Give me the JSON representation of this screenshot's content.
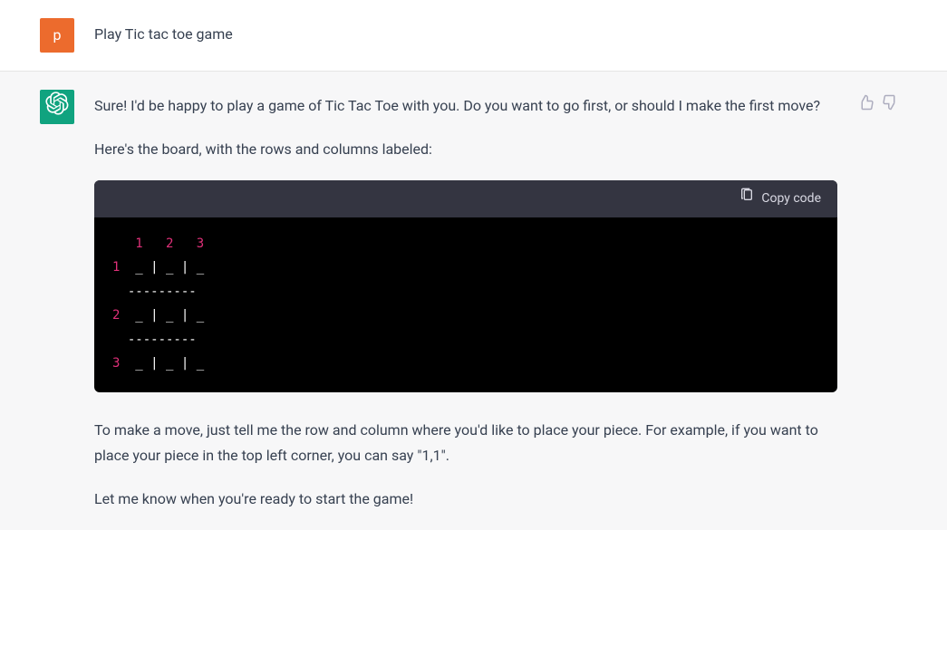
{
  "user": {
    "avatar_letter": "p",
    "message": "Play Tic tac toe game"
  },
  "assistant": {
    "paragraph1": "Sure! I'd be happy to play a game of Tic Tac Toe with you. Do you want to go first, or should I make the first move?",
    "paragraph2": "Here's the board, with the rows and columns labeled:",
    "paragraph3": "To make a move, just tell me the row and column where you'd like to place your piece. For example, if you want to place your piece in the top left corner, you can say \"1,1\".",
    "paragraph4": "Let me know when you're ready to start the game!"
  },
  "code": {
    "copy_label": "Copy code",
    "cols": {
      "c1": "1",
      "c2": "2",
      "c3": "3"
    },
    "rows": {
      "r1": "1",
      "r2": "2",
      "r3": "3"
    },
    "cell": "_",
    "pipe": "|",
    "divider": "---------"
  }
}
